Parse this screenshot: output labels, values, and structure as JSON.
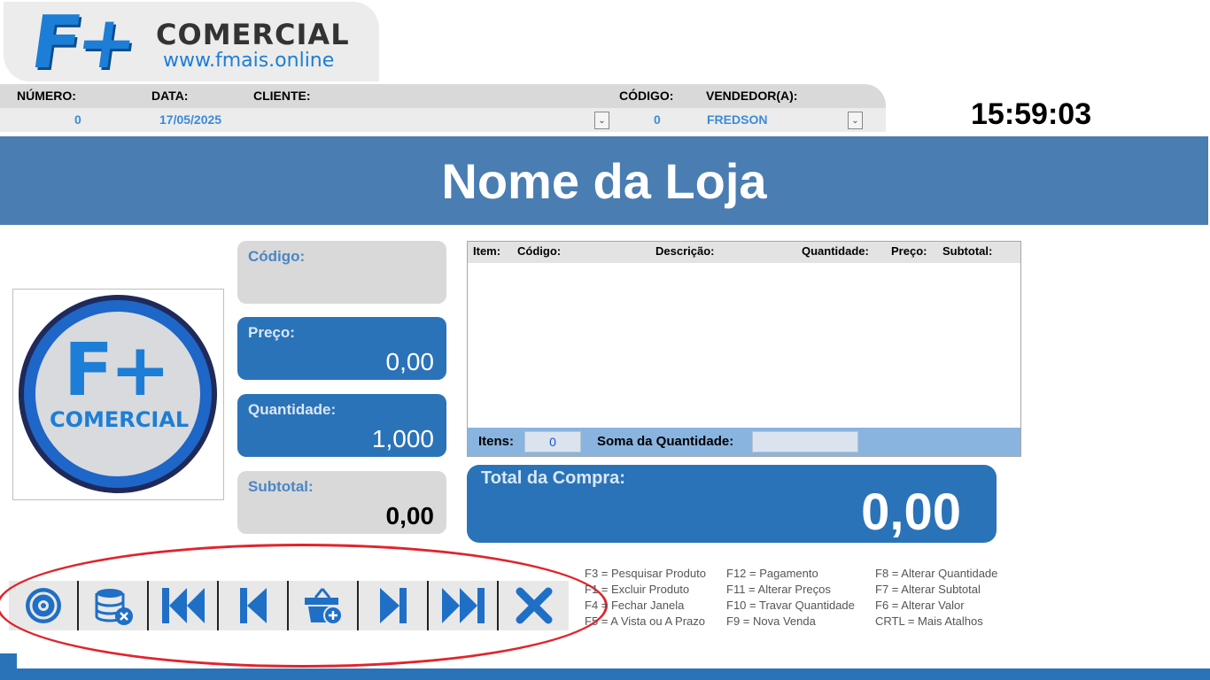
{
  "brand": {
    "logo_text": "F+",
    "name": "COMERCIAL",
    "url": "www.fmais.online"
  },
  "header": {
    "labels": {
      "numero": "NÚMERO:",
      "data": "DATA:",
      "cliente": "CLIENTE:",
      "codigo": "CÓDIGO:",
      "vendedor": "VENDEDOR(A):"
    },
    "values": {
      "numero": "0",
      "data": "17/05/2025",
      "cliente": "",
      "codigo": "0",
      "vendedor": "FREDSON"
    }
  },
  "clock": "15:59:03",
  "store": {
    "name": "Nome da Loja"
  },
  "logo_panel": {
    "logo_text": "F+",
    "word": "COMERCIAL"
  },
  "fields": {
    "codigo": {
      "label": "Código:",
      "value": ""
    },
    "preco": {
      "label": "Preço:",
      "value": "0,00"
    },
    "quantidade": {
      "label": "Quantidade:",
      "value": "1,000"
    },
    "subtotal": {
      "label": "Subtotal:",
      "value": "0,00"
    }
  },
  "items_table": {
    "columns": [
      "Item:",
      "Código:",
      "Descrição:",
      "Quantidade:",
      "Preço:",
      "Subtotal:"
    ],
    "rows": [],
    "footer": {
      "itens_label": "Itens:",
      "itens_value": "0",
      "soma_label": "Soma da Quantidade:",
      "soma_value": ""
    }
  },
  "total": {
    "label": "Total da Compra:",
    "value": "0,00"
  },
  "toolbar": {
    "buttons": [
      {
        "icon": "disc-icon"
      },
      {
        "icon": "database-delete-icon"
      },
      {
        "icon": "first-record-icon"
      },
      {
        "icon": "previous-record-icon"
      },
      {
        "icon": "basket-add-icon"
      },
      {
        "icon": "next-record-icon"
      },
      {
        "icon": "last-record-icon"
      },
      {
        "icon": "close-icon"
      }
    ]
  },
  "shortcuts": {
    "col1": [
      "F3 = Pesquisar Produto",
      "F1 = Excluir Produto",
      "F4 = Fechar Janela",
      "F5 = A Vista ou A Prazo"
    ],
    "col2": [
      "F12 = Pagamento",
      "F11 = Alterar Preços",
      "F10 = Travar Quantidade",
      "F9 = Nova Venda"
    ],
    "col3": [
      "F8 = Alterar Quantidade",
      "F7 = Alterar Subtotal",
      "F6 = Alterar Valor",
      "CRTL = Mais Atalhos"
    ]
  },
  "colors": {
    "primary_blue": "#2b73b8",
    "banner_blue": "#4a7db2",
    "accent_text_blue": "#3b8bd9",
    "highlight_red": "#e0242c"
  }
}
